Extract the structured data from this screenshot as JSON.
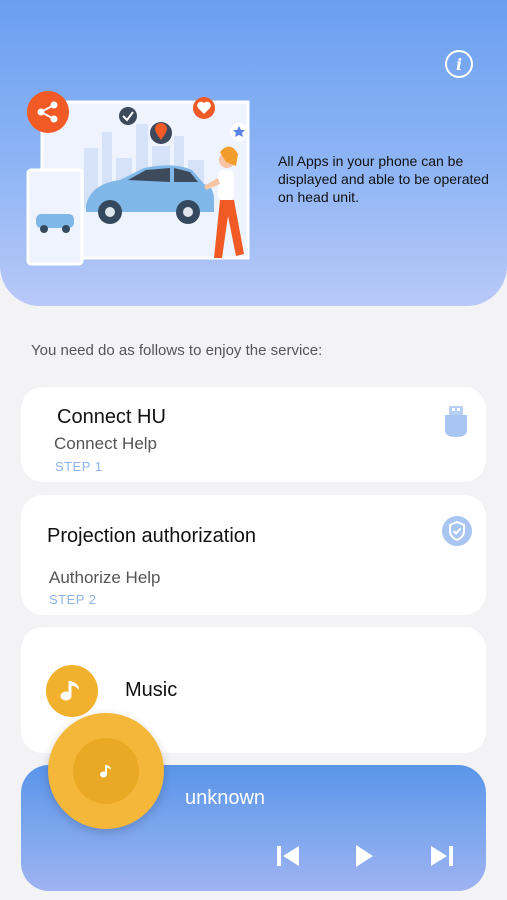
{
  "hero": {
    "description": "All Apps in your phone can be displayed and able to be operated on head unit.",
    "info_icon": "info-icon"
  },
  "intro_text": "You need do as follows to enjoy the service:",
  "steps": [
    {
      "title": "Connect HU",
      "subtitle": "Connect Help",
      "step": "STEP 1",
      "icon": "usb-icon"
    },
    {
      "title": "Projection authorization",
      "subtitle": "Authorize Help",
      "step": "STEP 2",
      "icon": "shield-check-icon"
    }
  ],
  "music": {
    "label": "Music",
    "icon": "music-note-icon"
  },
  "player": {
    "track": "unknown",
    "controls": [
      "previous-icon",
      "play-icon",
      "next-icon"
    ]
  },
  "colors": {
    "accent_blue": "#6a9ff0",
    "step_blue": "#8eb4ea",
    "music_orange": "#f2b12d"
  }
}
